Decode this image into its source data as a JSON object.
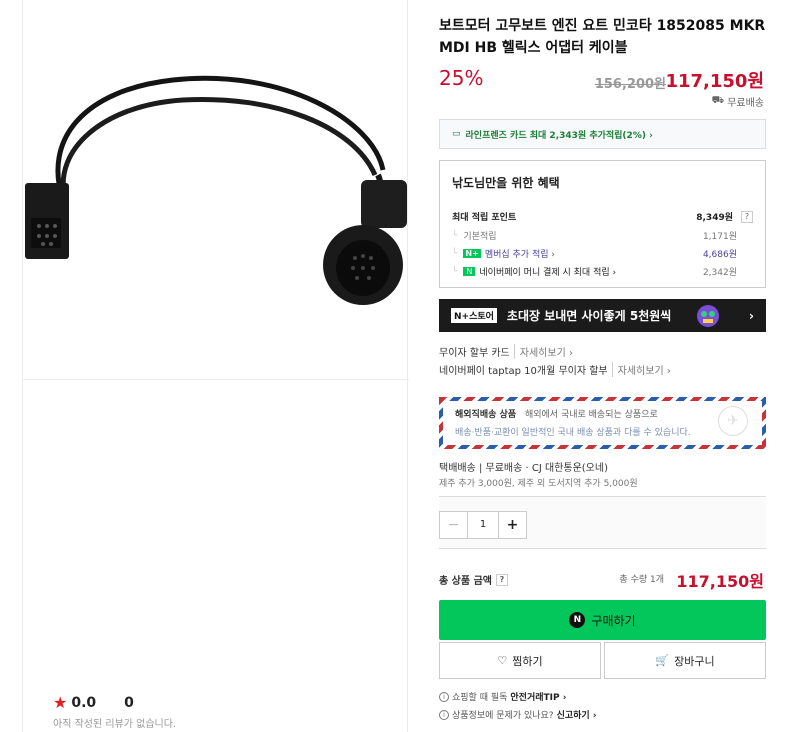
{
  "product": {
    "title": "보트모터 고무보트 엔진 요트 민코타 1852085 MKR MDI HB 헬릭스 어댑터 케이블",
    "discount": "25%",
    "original_price": "156,200원",
    "sale_price": "117,150원",
    "shipping_badge": "무료배송"
  },
  "card_promo": "라인프렌즈 카드 최대 2,343원 추가적립(2%) ›",
  "benefits": {
    "title": "낚도님만을 위한 혜택",
    "max_label": "최대 적립 포인트",
    "max_value": "8,349원",
    "basic_label": "기본적립",
    "basic_value": "1,171원",
    "membership_label": "멤버십 추가 적립 ›",
    "membership_value": "4,686원",
    "npay_label": "네이버페이 머니 결제 시 최대 적립 ›",
    "npay_value": "2,342원"
  },
  "banner": {
    "badge": "N+스토어",
    "text": "초대장 보내면 사이좋게 5천원씩",
    "arrow": "›"
  },
  "installment": {
    "line1_label": "무이자 할부 카드",
    "line1_detail": "자세히보기 ›",
    "line2_label": "네이버페이 taptap 10개월 무이자 할부",
    "line2_detail": "자세히보기 ›"
  },
  "overseas": {
    "title": "해외직배송 상품",
    "desc": "해외에서 국내로 배송되는 상품으로",
    "desc2": "배송·반품·교환이 일반적인 국내 배송 상품과 다를 수 있습니다."
  },
  "shipping": {
    "line1": "택배배송 | 무료배송 · CJ 대한통운(오네)",
    "line2": "제주 추가 3,000원, 제주 외 도서지역 추가 5,000원"
  },
  "quantity": {
    "minus": "−",
    "value": "1",
    "plus": "+"
  },
  "total": {
    "label": "총 상품 금액",
    "count": "총 수량 1개",
    "price": "117,150원"
  },
  "buttons": {
    "buy": "구매하기",
    "buy_icon": "N",
    "wish": "찜하기",
    "cart": "장바구니"
  },
  "footer": {
    "tip_text": "쇼핑할 때 필독",
    "tip_link": "안전거래TIP ›",
    "report_text": "상품정보에 문제가 있나요?",
    "report_link": "신고하기 ›"
  },
  "rating": {
    "score": "0.0",
    "count": "0",
    "empty_text": "아직 작성된 리뷰가 없습니다."
  }
}
